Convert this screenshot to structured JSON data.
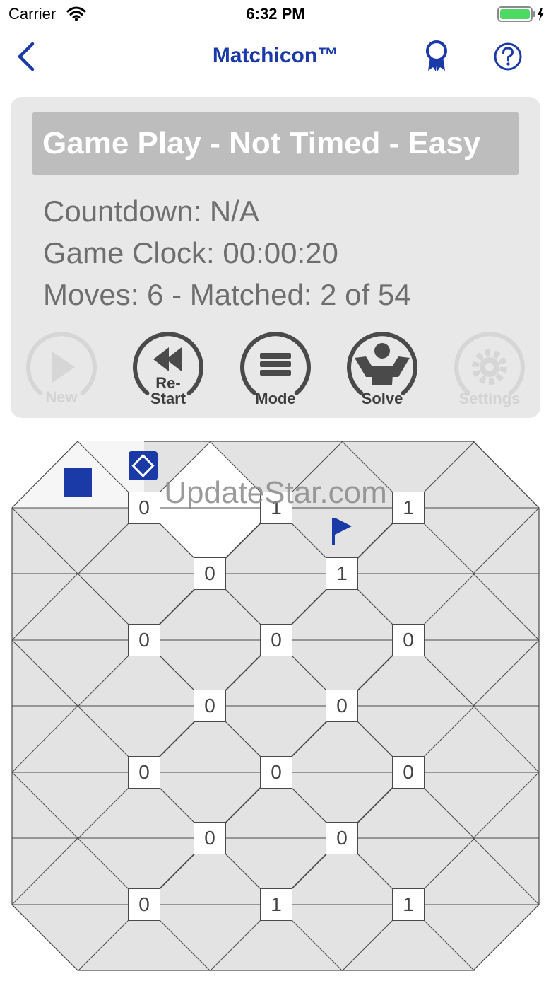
{
  "status_bar": {
    "carrier": "Carrier",
    "time": "6:32 PM"
  },
  "nav": {
    "title": "Matchicon™",
    "back_icon": "chevron-left-icon",
    "award_icon": "award-ribbon-icon",
    "help_icon": "question-circle-icon"
  },
  "panel": {
    "heading": "Game Play - Not Timed - Easy",
    "countdown": "Countdown: N/A",
    "game_clock": "Game Clock: 00:00:20",
    "moves": "Moves: 6 - Matched: 2 of 54"
  },
  "controls": {
    "new": "New",
    "restart_line1": "Re-",
    "restart_line2": "Start",
    "mode": "Mode",
    "solve": "Solve",
    "settings": "Settings"
  },
  "watermark": "UpdateStar.com",
  "colors": {
    "accent": "#1a3aa8",
    "tile": "#e3e3e3",
    "tile_revealed": "#f6f6f6",
    "panel": "#e8e8e8",
    "heading_bg": "#bdbdbd"
  },
  "board": {
    "counts": [
      [
        "0",
        "1",
        "1"
      ],
      [
        "0",
        "1"
      ],
      [
        "0",
        "0",
        "0"
      ],
      [
        "0",
        "0"
      ],
      [
        "0",
        "0",
        "0"
      ],
      [
        "0",
        "0"
      ],
      [
        "0",
        "1",
        "1"
      ]
    ],
    "markers": [
      "square-icon",
      "diamond-icon",
      "flag-icon"
    ]
  }
}
